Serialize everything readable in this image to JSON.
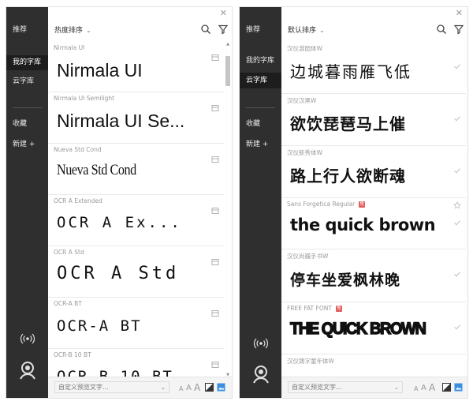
{
  "panels": [
    {
      "sidebar": {
        "items": [
          {
            "label": "推荐",
            "active": false
          },
          {
            "label": "我的字库",
            "active": true
          },
          {
            "label": "云字库",
            "active": false
          },
          {
            "label": "收藏",
            "active": false
          },
          {
            "label": "新建 +",
            "active": false
          }
        ]
      },
      "toolbar": {
        "sort_label": "热度排序"
      },
      "fonts": [
        {
          "name": "Nirmala UI",
          "preview": "Nirmala UI",
          "badge": "",
          "action": "save-icon"
        },
        {
          "name": "Nirmala UI Semilight",
          "preview": "Nirmala UI Se...",
          "badge": "",
          "action": "save-icon"
        },
        {
          "name": "Nueva Std Cond",
          "preview": "Nueva Std Cond",
          "badge": "",
          "action": "save-icon"
        },
        {
          "name": "OCR A Extended",
          "preview": "OCR A Ex...",
          "badge": "",
          "action": "save-icon"
        },
        {
          "name": "OCR A Std",
          "preview": "OCR A Std",
          "badge": "",
          "action": "save-icon"
        },
        {
          "name": "OCR-A BT",
          "preview": "OCR-A BT",
          "badge": "",
          "action": "save-icon"
        },
        {
          "name": "OCR-B 10 BT",
          "preview": "OCR-B 10 BT",
          "badge": "",
          "action": "save-icon"
        }
      ],
      "bottom": {
        "placeholder": "自定义预览文字...",
        "size_small": "A",
        "size_medium": "A",
        "size_large": "A"
      }
    },
    {
      "sidebar": {
        "items": [
          {
            "label": "推荐",
            "active": false
          },
          {
            "label": "我的字库",
            "active": false
          },
          {
            "label": "云字库",
            "active": true
          },
          {
            "label": "收藏",
            "active": false
          },
          {
            "label": "新建 +",
            "active": false
          }
        ]
      },
      "toolbar": {
        "sort_label": "默认排序"
      },
      "fonts": [
        {
          "name": "汉仪游园体W",
          "preview": "边城暮雨雁飞低",
          "badge": "",
          "action": "check-icon"
        },
        {
          "name": "汉仪汉黑W",
          "preview": "欲饮琵琶马上催",
          "badge": "",
          "action": "check-icon"
        },
        {
          "name": "汉仪新秀体W",
          "preview": "路上行人欲断魂",
          "badge": "",
          "action": "check-icon"
        },
        {
          "name": "Sans Forgetica Regular",
          "preview": "the quick brown",
          "badge": "免",
          "action": "star-icon"
        },
        {
          "name": "汉仪尚巍手书W",
          "preview": "停车坐爱枫林晚",
          "badge": "",
          "action": "check-icon"
        },
        {
          "name": "FREE FAT FONT",
          "preview": "THE QUICK BROWN",
          "badge": "免",
          "action": "check-icon"
        },
        {
          "name": "汉仪铸字童年体W",
          "preview": "",
          "badge": "",
          "action": "check-icon"
        }
      ],
      "bottom": {
        "placeholder": "自定义预览文字...",
        "size_small": "A",
        "size_medium": "A",
        "size_large": "A"
      }
    }
  ],
  "colors": {
    "sidebar_bg": "#2f2f2f",
    "sidebar_active": "#1d1d1d",
    "badge": "#e15a5a",
    "accent_blue": "#3d8fe0"
  }
}
